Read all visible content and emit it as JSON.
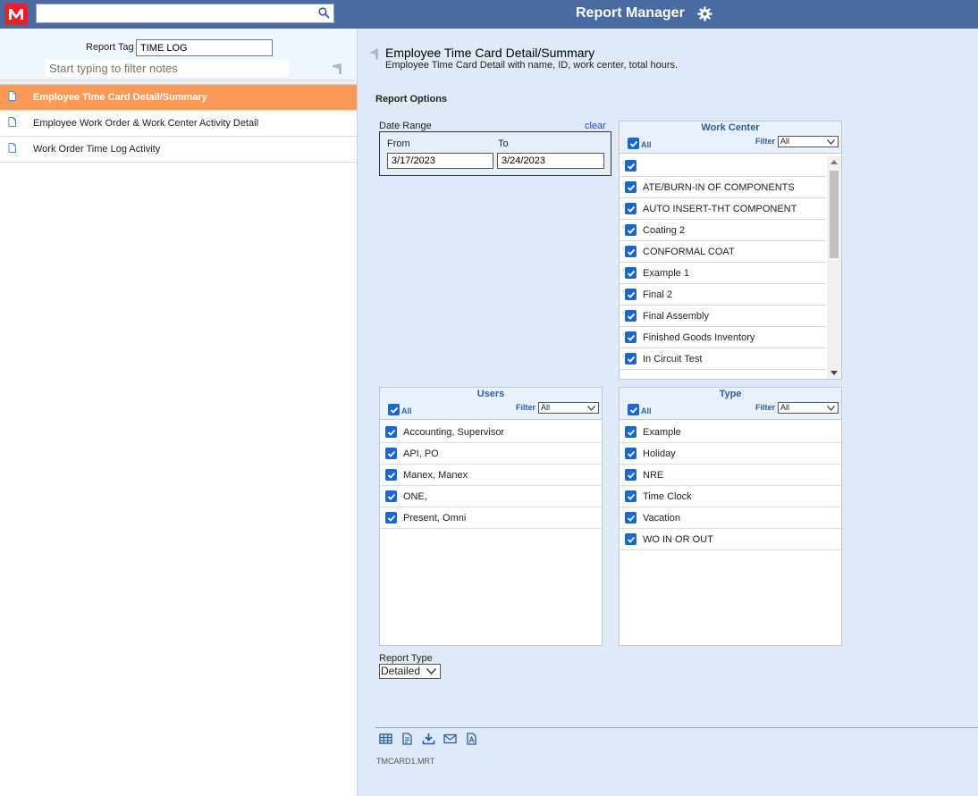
{
  "app": {
    "title": "Report Manager",
    "search_value": ""
  },
  "left": {
    "tag_label": "Report Tag",
    "tag_value": "TIME LOG",
    "filter_placeholder": "Start typing to filter notes",
    "reports": [
      {
        "label": "Employee Time Card Detail/Summary",
        "active": true
      },
      {
        "label": "Employee Work Order & Work Center Activity Detail",
        "active": false
      },
      {
        "label": "Work Order Time Log Activity",
        "active": false
      }
    ]
  },
  "report": {
    "title": "Employee Time Card Detail/Summary",
    "description": "Employee Time Card Detail with name, ID, work center, total hours.",
    "options_label": "Report Options",
    "date_range_label": "Date Range",
    "clear_label": "clear",
    "from_label": "From",
    "to_label": "To",
    "from_value": "3/17/2023",
    "to_value": "3/24/2023",
    "report_type_label": "Report Type",
    "report_type_value": "Detailed",
    "file_name": "TMCARD1.MRT"
  },
  "work_center": {
    "title": "Work Center",
    "all_label": "All",
    "filter_label": "Filter",
    "filter_value": "All",
    "items": [
      "",
      "ATE/BURN-IN OF COMPONENTS",
      "AUTO INSERT-THT COMPONENT",
      "Coating 2",
      "CONFORMAL COAT",
      "Example 1",
      "Final 2",
      "Final Assembly",
      "Finished Goods Inventory",
      "In Circuit Test"
    ]
  },
  "users": {
    "title": "Users",
    "all_label": "All",
    "filter_label": "Filter",
    "filter_value": "All",
    "items": [
      "Accounting, Supervisor",
      "API, PO",
      "Manex, Manex",
      "ONE,",
      "Present, Omni"
    ]
  },
  "type": {
    "title": "Type",
    "all_label": "All",
    "filter_label": "Filter",
    "filter_value": "All",
    "items": [
      "Example",
      "Holiday",
      "NRE",
      "Time Clock",
      "Vacation",
      "WO IN OR OUT"
    ]
  },
  "colors": {
    "topbar": "#4a6aa2",
    "active_item": "#fd9a58",
    "checkbox": "#1967d2",
    "panel_title": "#2d5d9e"
  }
}
